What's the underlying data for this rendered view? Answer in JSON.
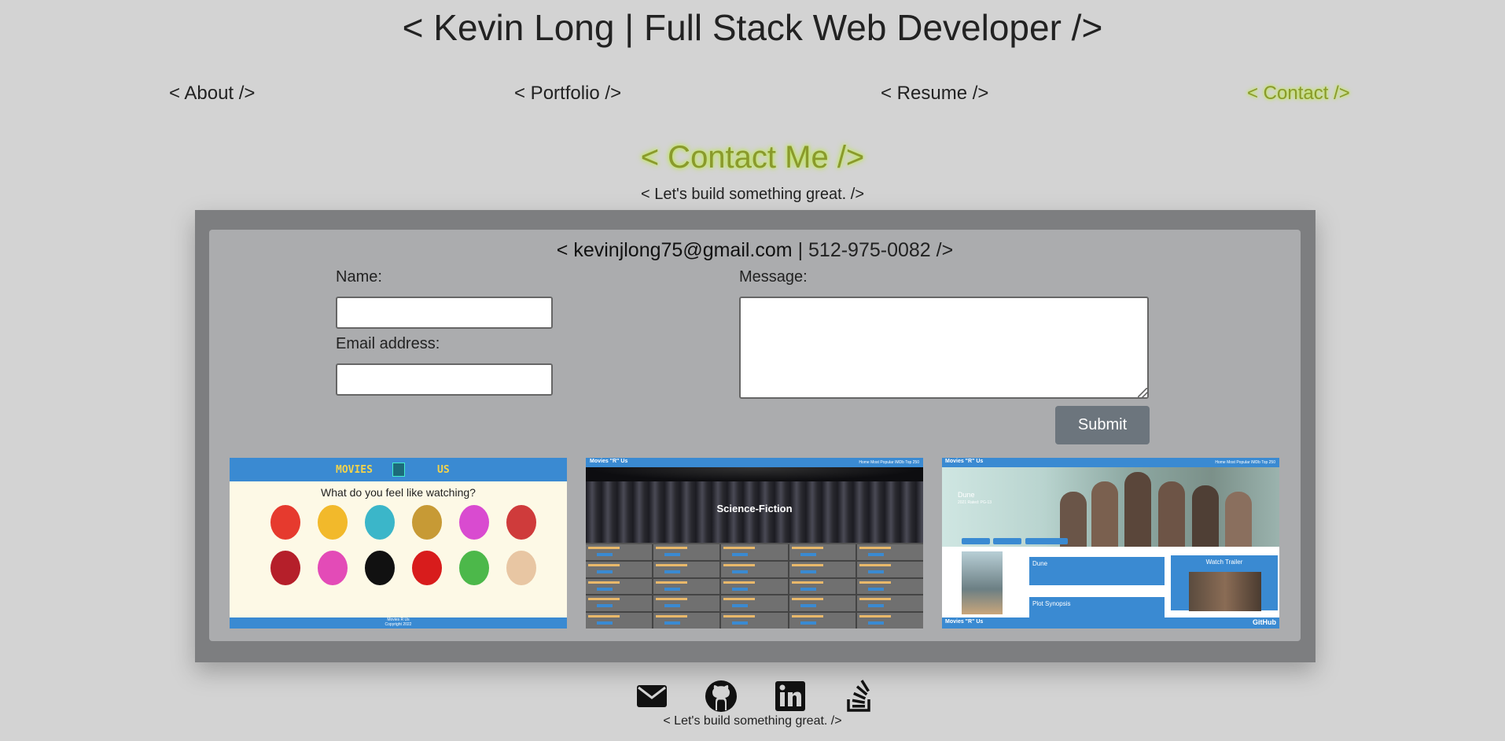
{
  "header": {
    "title": "< Kevin Long | Full Stack Web Developer />"
  },
  "nav": {
    "items": [
      {
        "label": "< About />",
        "active": false
      },
      {
        "label": "< Portfolio />",
        "active": false
      },
      {
        "label": "< Resume />",
        "active": false
      },
      {
        "label": "< Contact />",
        "active": true
      }
    ]
  },
  "contact": {
    "heading": "< Contact Me />",
    "tagline": "< Let's build something great. />",
    "line_prefix": "< ",
    "email": "kevinjlong75@gmail.com",
    "separator": " | ",
    "phone": "512-975-0082",
    "line_suffix": " />"
  },
  "form": {
    "name_label": "Name:",
    "name_value": "",
    "email_label": "Email address:",
    "email_value": "",
    "message_label": "Message:",
    "message_value": "",
    "submit_label": "Submit"
  },
  "thumbnails": [
    {
      "logo_left": "MOVIES",
      "logo_right": "US",
      "question": "What do you feel like watching?",
      "footer_line1": "Movies R Us",
      "footer_line2": "Copyright 2022"
    },
    {
      "brand": "Movies \"R\" Us",
      "links": "Home    Most Popular    IMDb Top 250",
      "banner": "Science-Fiction"
    },
    {
      "brand": "Movies \"R\" Us",
      "links": "Home    Most Popular    IMDb Top 250",
      "title": "Dune",
      "subtitle": "2021 Rated: PG-13",
      "card_title": "Dune",
      "synopsis_title": "Plot Synopsis",
      "trailer_title": "Watch Trailer",
      "footer_brand": "Movies \"R\" Us",
      "footer_link": "GitHub"
    }
  ],
  "footer": {
    "icons": [
      "envelope-icon",
      "github-icon",
      "linkedin-icon",
      "stack-overflow-icon"
    ],
    "tagline": "< Let's build something great. />"
  },
  "colors": {
    "background": "#d3d3d3",
    "active_link": "#8a9a2c",
    "glow": "#b9e04a",
    "outer_panel": "#7d7e80",
    "inner_panel": "#abacae",
    "submit": "#6c757d",
    "thumb_blue": "#3a8ad2"
  }
}
